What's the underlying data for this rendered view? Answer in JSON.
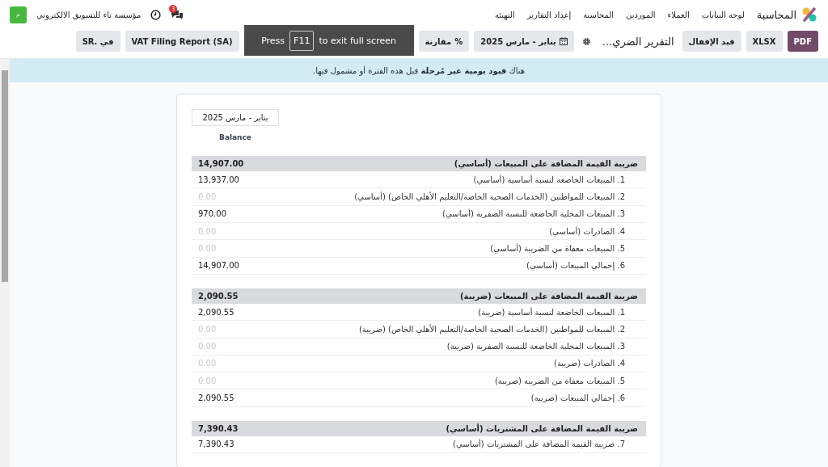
{
  "navbar": {
    "app_name": "المحاسبة",
    "menu": [
      {
        "label": "لوحة البيانات"
      },
      {
        "label": "العملاء"
      },
      {
        "label": "الموردين"
      },
      {
        "label": "المحاسبة"
      },
      {
        "label": "إعداد التقارير"
      },
      {
        "label": "التهيئة"
      }
    ],
    "chat_badge": "3",
    "company": "مؤسسة تاء للتسويق الالكتروني",
    "avatar": "م"
  },
  "toolbar": {
    "buttons": [
      {
        "label": "PDF",
        "kind": "primary"
      },
      {
        "label": "XLSX",
        "kind": "secondary"
      },
      {
        "label": "قيد الإقفال",
        "kind": "secondary"
      }
    ],
    "title": "التقرير الضري...",
    "filters": [
      {
        "label": "يناير - مارس 2025",
        "kind": "date"
      },
      {
        "label": "مقارنة",
        "kind": "compare",
        "symbol": "%"
      },
      {
        "label": "VAT Filing Report (SA)",
        "kind": "plain"
      },
      {
        "label": "في .SR",
        "kind": "plain"
      }
    ]
  },
  "fullscreen_hint": {
    "before": "Press",
    "key": "F11",
    "after": "to exit full screen"
  },
  "alert": "هناك **قيود يومية غير مُرحلة** قبل هذه الفترة أو مشمول فيها.",
  "report": {
    "period": "يناير - مارس 2025",
    "column": "Balance",
    "sections": [
      {
        "title": "ضريبة القيمة المضافة على المبيعات (أساسي)",
        "total": "14,907.00",
        "lines": [
          {
            "label": "1. المبيعات الخاضعة لنسبة أساسية (أساسي)",
            "amount": "13,937.00",
            "muted": false
          },
          {
            "label": "2. المبيعات للمواطنين (الخدمات الصحية الخاصة/التعليم الأهلي الخاص) (أساسي)",
            "amount": "0.00",
            "muted": true
          },
          {
            "label": "3. المبيعات المحلية الخاضعة للنسبة الصفرية (أساسي)",
            "amount": "970.00",
            "muted": false
          },
          {
            "label": "4. الصادرات (أساسي)",
            "amount": "0.00",
            "muted": true
          },
          {
            "label": "5. المبيعات معفاة من الضريبة (أساسي)",
            "amount": "0.00",
            "muted": true
          },
          {
            "label": "6. إجمالي المبيعات (أساسي)",
            "amount": "14,907.00",
            "muted": false
          }
        ]
      },
      {
        "title": "ضريبة القيمة المضافة على المبيعات (ضريبة)",
        "total": "2,090.55",
        "lines": [
          {
            "label": "1. المبيعات الخاضعة لنسبة أساسية (ضريبة)",
            "amount": "2,090.55",
            "muted": false
          },
          {
            "label": "2. المبيعات للمواطنين (الخدمات الصحية الخاصة/التعليم الأهلي الخاص) (ضريبة)",
            "amount": "0.00",
            "muted": true
          },
          {
            "label": "3. المبيعات المحلية الخاضعة للنسبة الصفرية (ضريبة)",
            "amount": "0.00",
            "muted": true
          },
          {
            "label": "4. الصادرات (ضريبة)",
            "amount": "0.00",
            "muted": true
          },
          {
            "label": "5. المبيعات معفاة من الضريبة (ضريبة)",
            "amount": "0.00",
            "muted": true
          },
          {
            "label": "6. إجمالي المبيعات (ضريبة)",
            "amount": "2,090.55",
            "muted": false
          }
        ]
      },
      {
        "title": "ضريبة القيمة المضافة على المشتريات (أساسي)",
        "total": "7,390.43",
        "lines": [
          {
            "label": "7. ضريبة القيمة المضافة على المشتريات (أساسي)",
            "amount": "7,390.43",
            "muted": false
          }
        ]
      }
    ]
  }
}
